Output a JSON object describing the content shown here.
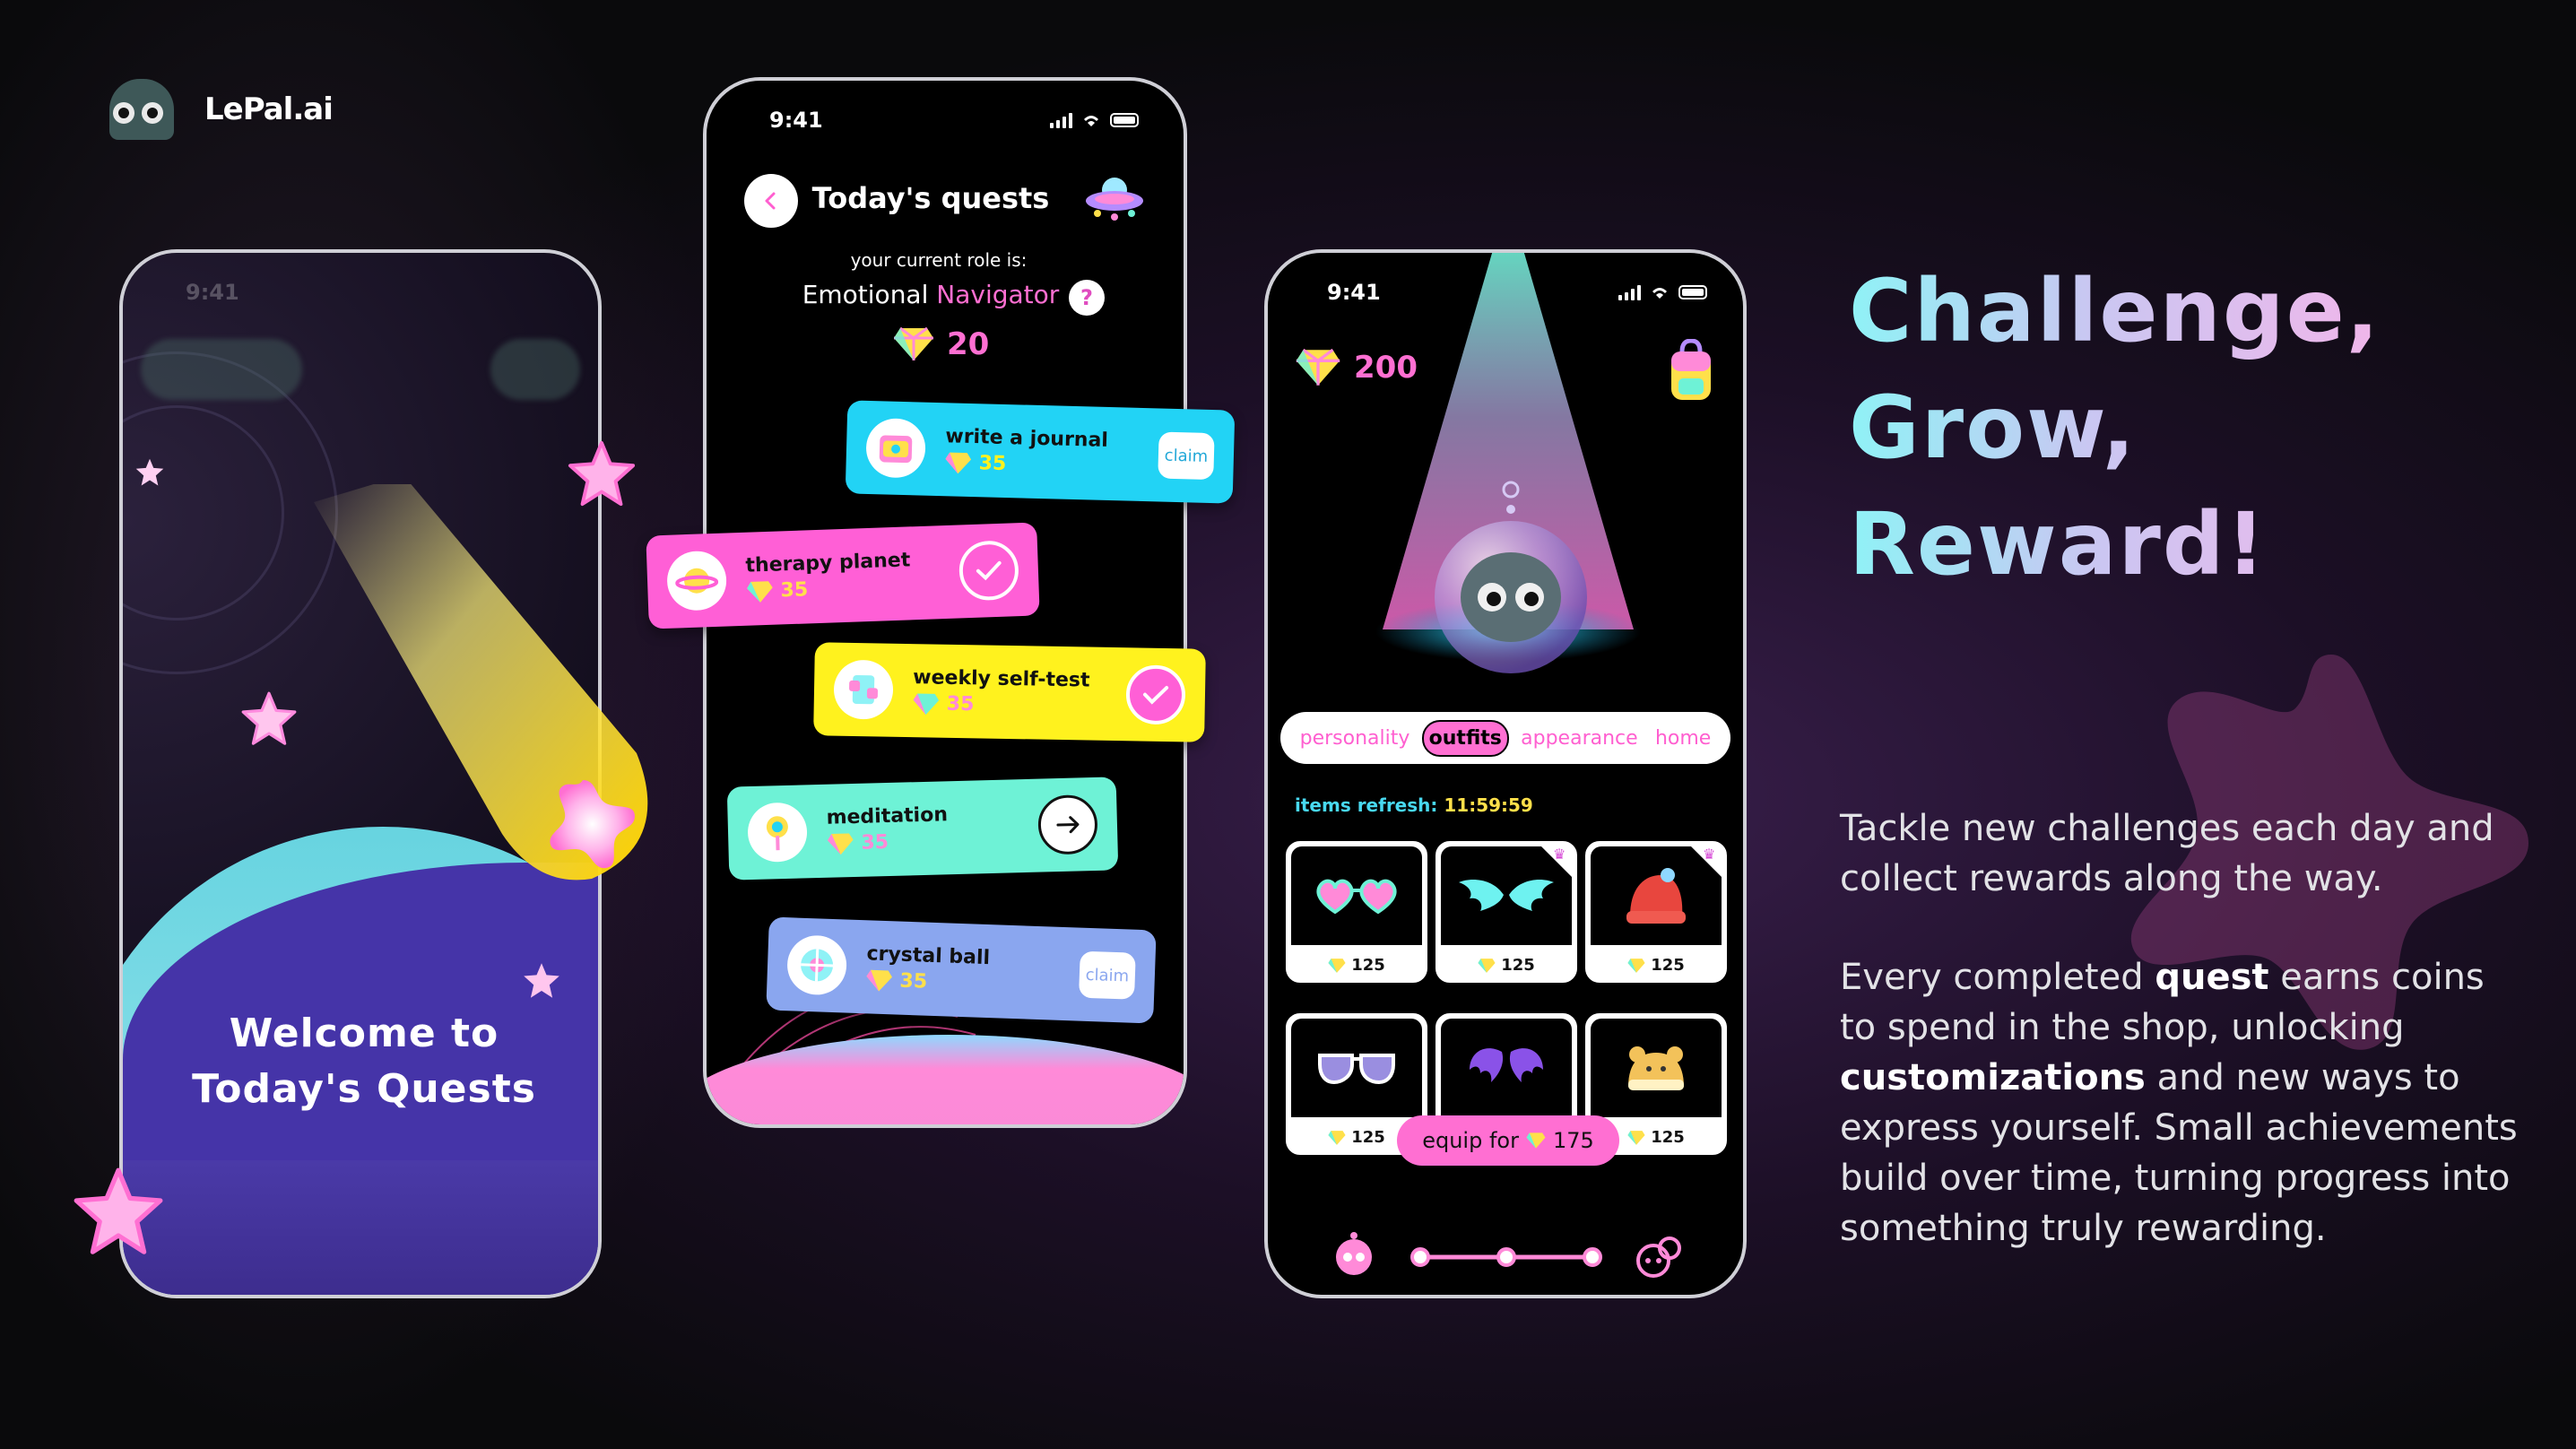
{
  "brand": {
    "name": "LePal.ai"
  },
  "headline": [
    "Challenge,",
    "Grow,",
    "Reward!"
  ],
  "paragraph1": "Tackle new challenges each day and collect rewards along the way.",
  "paragraph2": {
    "p1": "Every completed ",
    "b1": "quest",
    "p2": " earns coins to spend in the shop, unlocking ",
    "b2": "customizations",
    "p3": " and new ways to express yourself. Small achievements build over time, turning progress into something truly rewarding."
  },
  "phone1": {
    "time": "9:41",
    "welcome_line1": "Welcome to",
    "welcome_line2": "Today's Quests"
  },
  "phone2": {
    "time": "9:41",
    "title": "Today's quests",
    "role_caption": "your current role is:",
    "role_prefix": "Emotional",
    "role_name": "Navigator",
    "help": "?",
    "gems": "20",
    "quests": [
      {
        "name": "write a journal",
        "reward": "35",
        "action": "claim",
        "color": "#22d3f5"
      },
      {
        "name": "therapy planet",
        "reward": "35",
        "action": "done",
        "color": "#ff5fd6"
      },
      {
        "name": "weekly self-test",
        "reward": "35",
        "action": "done",
        "color": "#fff21e"
      },
      {
        "name": "meditation",
        "reward": "35",
        "action": "go",
        "color": "#6ef2d6"
      },
      {
        "name": "crystal ball",
        "reward": "35",
        "action": "claim",
        "color": "#8aa6ef"
      }
    ]
  },
  "phone3": {
    "time": "9:41",
    "gems": "200",
    "tabs": [
      "personality",
      "outfits",
      "appearance",
      "home"
    ],
    "active_tab": "outfits",
    "refresh_label": "items refresh:",
    "refresh_time": "11:59:59",
    "items": [
      {
        "icon": "heart-glasses",
        "price": "125"
      },
      {
        "icon": "angel-wings",
        "price": "125"
      },
      {
        "icon": "red-beanie",
        "price": "125"
      },
      {
        "icon": "sunglasses",
        "price": "125"
      },
      {
        "icon": "bat-wings",
        "price": "125"
      },
      {
        "icon": "bear-hat",
        "price": "125"
      }
    ],
    "equip_label": "equip for",
    "equip_price": "175"
  },
  "colors": {
    "pink": "#ff6fd2",
    "cyan": "#48d8f0",
    "yellow": "#ffe04a",
    "purple": "#4534a8"
  }
}
